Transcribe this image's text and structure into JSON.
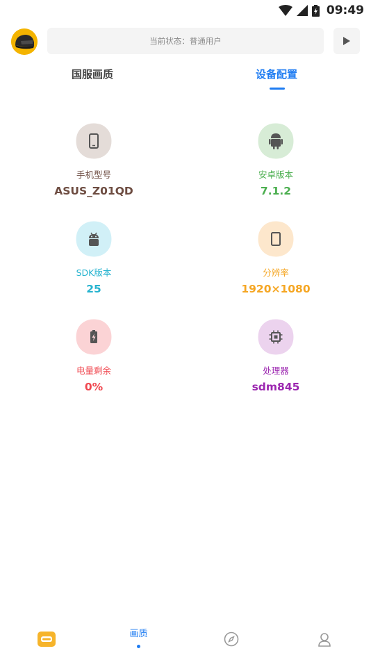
{
  "status_bar": {
    "time": "09:49"
  },
  "header": {
    "status_text": "当前状态：普通用户"
  },
  "tabs": [
    {
      "label": "国服画质",
      "active": false
    },
    {
      "label": "设备配置",
      "active": true
    }
  ],
  "device_info": [
    {
      "key": "model",
      "label": "手机型号",
      "value": "ASUS_Z01QD",
      "icon": "phone-icon",
      "label_color": "#6d4c41",
      "value_color": "#6d4c41",
      "blob_color": "#e4dcd8"
    },
    {
      "key": "android",
      "label": "安卓版本",
      "value": "7.1.2",
      "icon": "android-icon",
      "label_color": "#4caf50",
      "value_color": "#4caf50",
      "blob_color": "#d7ecd6"
    },
    {
      "key": "sdk",
      "label": "SDK版本",
      "value": "25",
      "icon": "android-bot-icon",
      "label_color": "#26b3cf",
      "value_color": "#26b3cf",
      "blob_color": "#d1f0f7"
    },
    {
      "key": "resolution",
      "label": "分辨率",
      "value": "1920×1080",
      "icon": "tablet-icon",
      "label_color": "#f5a623",
      "value_color": "#f5a623",
      "blob_color": "#fde7cc"
    },
    {
      "key": "battery",
      "label": "电量剩余",
      "value": "0%",
      "icon": "battery-icon",
      "label_color": "#f0474f",
      "value_color": "#f0474f",
      "blob_color": "#fbd3d5"
    },
    {
      "key": "cpu",
      "label": "处理器",
      "value": "sdm845",
      "icon": "cpu-icon",
      "label_color": "#9c27b0",
      "value_color": "#9c27b0",
      "blob_color": "#ecd3ee"
    }
  ],
  "bottom_nav": [
    {
      "label": "",
      "icon": "pubg-app-icon"
    },
    {
      "label": "画质",
      "icon": "",
      "active": true
    },
    {
      "label": "",
      "icon": "compass-icon"
    },
    {
      "label": "",
      "icon": "profile-icon"
    }
  ]
}
